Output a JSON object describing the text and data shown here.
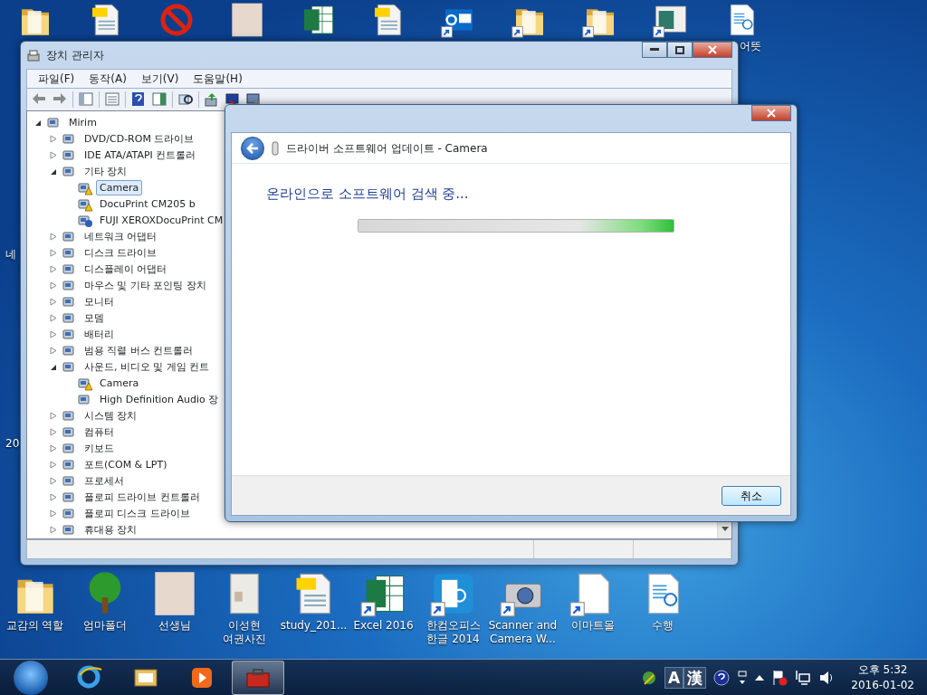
{
  "desktop": {
    "top_icons": [
      {
        "kind": "folder",
        "shortcut": false
      },
      {
        "kind": "pdf",
        "shortcut": false
      },
      {
        "kind": "blocked",
        "shortcut": false
      },
      {
        "kind": "photo",
        "shortcut": false
      },
      {
        "kind": "excel",
        "shortcut": false
      },
      {
        "kind": "pdf",
        "shortcut": false
      },
      {
        "kind": "outlook",
        "shortcut": true
      },
      {
        "kind": "folder",
        "shortcut": true
      },
      {
        "kind": "folder",
        "shortcut": true
      },
      {
        "kind": "window",
        "shortcut": true
      },
      {
        "kind": "hwp",
        "shortcut": false,
        "label": "어뜻"
      }
    ],
    "edge_labels": [
      "네",
      "20"
    ],
    "bottom_icons": [
      {
        "kind": "folder",
        "shortcut": false,
        "label": "교감의 역할"
      },
      {
        "kind": "tree",
        "shortcut": false,
        "label": "엄마폴더"
      },
      {
        "kind": "photo",
        "shortcut": false,
        "label": "선생님"
      },
      {
        "kind": "passport",
        "shortcut": false,
        "label": "이성현\n여권사진"
      },
      {
        "kind": "pdf",
        "shortcut": false,
        "label": "study_201..."
      },
      {
        "kind": "excel",
        "shortcut": true,
        "label": "Excel 2016"
      },
      {
        "kind": "hwpapp",
        "shortcut": true,
        "label": "한컴오피스\n한글 2014"
      },
      {
        "kind": "scanner",
        "shortcut": true,
        "label": "Scanner and\nCamera W..."
      },
      {
        "kind": "blank",
        "shortcut": true,
        "label": "이마트몰"
      },
      {
        "kind": "hwp",
        "shortcut": false,
        "label": "수행"
      }
    ]
  },
  "device_manager": {
    "title": "장치 관리자",
    "menu": [
      "파일(F)",
      "동작(A)",
      "보기(V)",
      "도움말(H)"
    ],
    "tree": {
      "label": "Mirim",
      "expanded": true,
      "selected": false,
      "children": [
        {
          "label": "DVD/CD-ROM 드라이브",
          "expanded": false,
          "selected": false
        },
        {
          "label": "IDE ATA/ATAPI 컨트롤러",
          "expanded": false,
          "selected": false
        },
        {
          "label": "기타 장치",
          "expanded": true,
          "selected": false,
          "children": [
            {
              "label": "Camera",
              "kind": "warning",
              "selected": true
            },
            {
              "label": "DocuPrint CM205 b",
              "kind": "warning",
              "selected": false
            },
            {
              "label": "FUJI XEROXDocuPrint CM",
              "kind": "unknown",
              "selected": false
            }
          ]
        },
        {
          "label": "네트워크 어댑터",
          "expanded": false,
          "selected": false
        },
        {
          "label": "디스크 드라이브",
          "expanded": false,
          "selected": false
        },
        {
          "label": "디스플레이 어댑터",
          "expanded": false,
          "selected": false
        },
        {
          "label": "마우스 및 기타 포인팅 장치",
          "expanded": false,
          "selected": false
        },
        {
          "label": "모니터",
          "expanded": false,
          "selected": false
        },
        {
          "label": "모뎀",
          "expanded": false,
          "selected": false
        },
        {
          "label": "배터리",
          "expanded": false,
          "selected": false
        },
        {
          "label": "범용 직렬 버스 컨트롤러",
          "expanded": false,
          "selected": false
        },
        {
          "label": "사운드, 비디오 및 게임 컨트",
          "expanded": true,
          "selected": false,
          "children": [
            {
              "label": "Camera",
              "kind": "warning",
              "selected": false
            },
            {
              "label": "High Definition Audio 장",
              "kind": "device",
              "selected": false
            }
          ]
        },
        {
          "label": "시스템 장치",
          "expanded": false,
          "selected": false
        },
        {
          "label": "컴퓨터",
          "expanded": false,
          "selected": false
        },
        {
          "label": "키보드",
          "expanded": false,
          "selected": false
        },
        {
          "label": "포트(COM & LPT)",
          "expanded": false,
          "selected": false
        },
        {
          "label": "프로세서",
          "expanded": false,
          "selected": false
        },
        {
          "label": "플로피 드라이브 컨트롤러",
          "expanded": false,
          "selected": false
        },
        {
          "label": "플로피 디스크 드라이브",
          "expanded": false,
          "selected": false
        },
        {
          "label": "휴대용 장치",
          "expanded": false,
          "selected": false
        }
      ]
    }
  },
  "dialog": {
    "title": "드라이버 소프트웨어 업데이트 - Camera",
    "heading": "온라인으로 소프트웨어 검색 중...",
    "cancel": "취소",
    "progress": {
      "level": 1
    }
  },
  "taskbar": {
    "items": [
      {
        "kind": "ie",
        "selected": false
      },
      {
        "kind": "explorer",
        "selected": false
      },
      {
        "kind": "media",
        "selected": false
      },
      {
        "kind": "toolbox",
        "selected": true
      }
    ],
    "ime": [
      "A",
      "漢"
    ],
    "time": "오후 5:32",
    "date": "2016-01-02"
  }
}
